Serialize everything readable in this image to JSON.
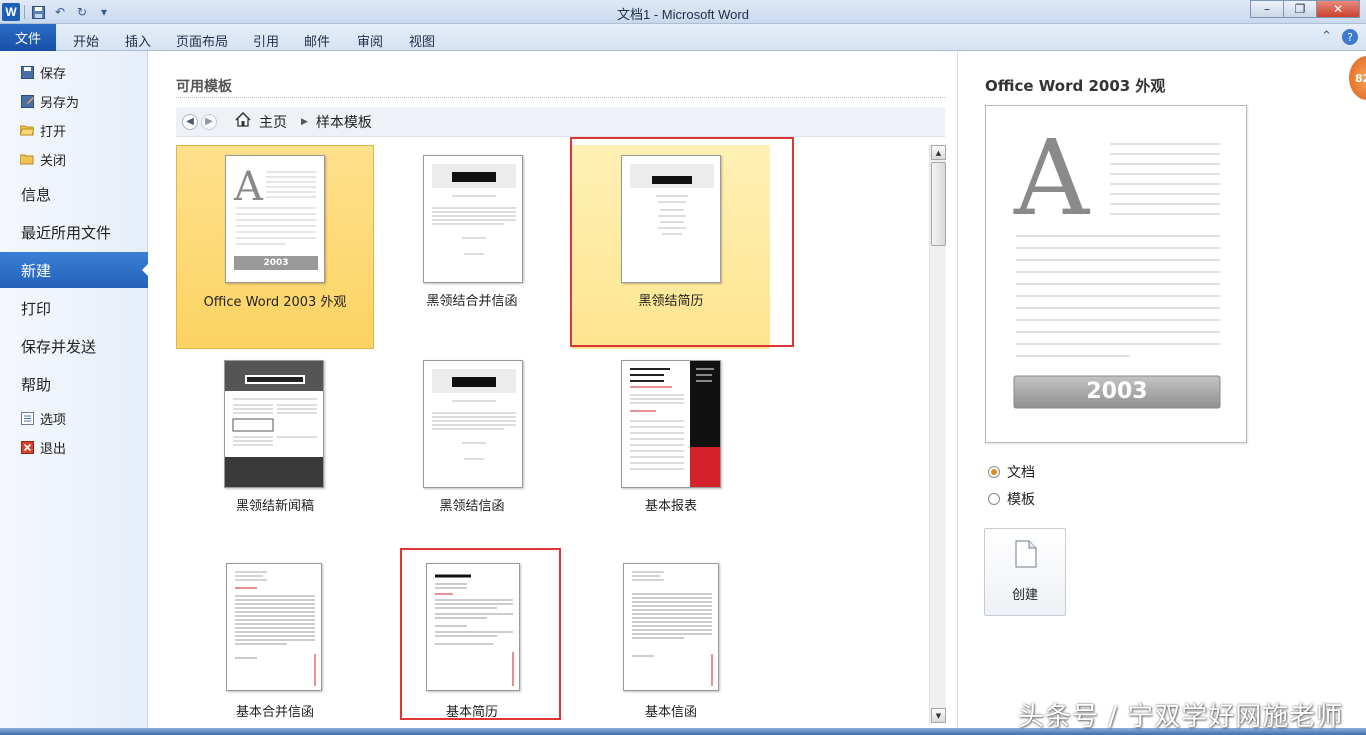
{
  "window": {
    "title": "文档1 - Microsoft Word",
    "app_letter": "W",
    "controls": [
      "–",
      "❐",
      "✕"
    ]
  },
  "ribbon": {
    "file_tab": "文件",
    "tabs": [
      "开始",
      "插入",
      "页面布局",
      "引用",
      "邮件",
      "审阅",
      "视图"
    ],
    "help": "?"
  },
  "nav": {
    "small_top": [
      {
        "label": "保存",
        "icon": "save-icon"
      },
      {
        "label": "另存为",
        "icon": "save-as-icon"
      },
      {
        "label": "打开",
        "icon": "open-folder-icon"
      },
      {
        "label": "关闭",
        "icon": "close-folder-icon"
      }
    ],
    "big": [
      "信息",
      "最近所用文件",
      "新建",
      "打印",
      "保存并发送",
      "帮助"
    ],
    "active": "新建",
    "small_bottom": [
      {
        "label": "选项",
        "icon": "options-icon"
      },
      {
        "label": "退出",
        "icon": "exit-icon"
      }
    ]
  },
  "center": {
    "section_title": "可用模板",
    "breadcrumb": {
      "home": "主页",
      "current": "样本模板"
    },
    "templates": [
      {
        "label": "Office Word 2003 外观",
        "state": "selected",
        "thumb_badge": "2003"
      },
      {
        "label": "黑领结合并信函",
        "state": "normal"
      },
      {
        "label": "黑领结简历",
        "state": "hover",
        "highlighted": true
      },
      {
        "label": "黑领结新闻稿",
        "state": "normal"
      },
      {
        "label": "黑领结信函",
        "state": "normal"
      },
      {
        "label": "基本报表",
        "state": "normal"
      },
      {
        "label": "基本合并信函",
        "state": "normal"
      },
      {
        "label": "基本简历",
        "state": "normal",
        "highlighted": true
      },
      {
        "label": "基本信函",
        "state": "normal"
      }
    ]
  },
  "preview": {
    "title": "Office Word 2003 外观",
    "badge_text": "2003",
    "big_letter": "A",
    "options": [
      {
        "label": "文档",
        "checked": true
      },
      {
        "label": "模板",
        "checked": false
      }
    ],
    "create_label": "创建"
  },
  "overlay": {
    "badge": "82",
    "watermark": "头条号 / 宁双学好网施老师"
  },
  "colors": {
    "accent": "#2462b8",
    "selected_tile": "#fcd363",
    "highlight_box": "#e03535"
  }
}
